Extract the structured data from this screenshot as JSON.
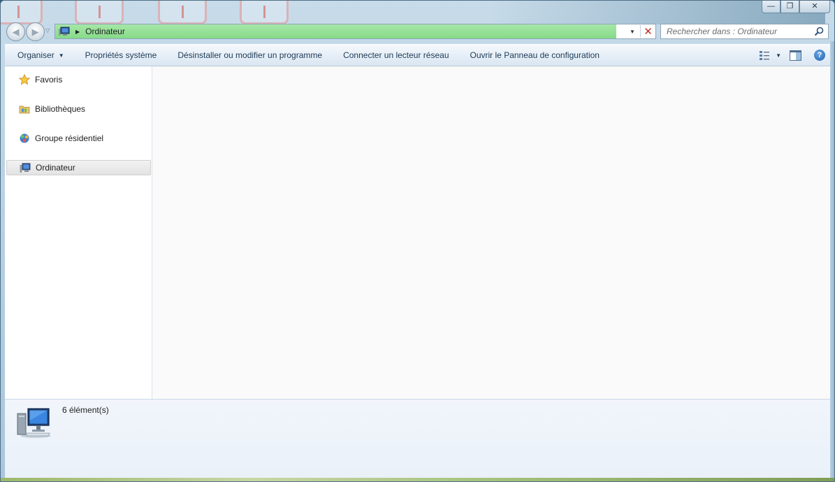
{
  "window": {
    "caption": {
      "minimize": "—",
      "maximize": "❐",
      "close": "✕"
    }
  },
  "navigation": {
    "back_glyph": "◀",
    "forward_glyph": "▶",
    "recent_glyph": "▽"
  },
  "address_bar": {
    "breadcrumb_separator": "▶",
    "location": "Ordinateur",
    "dropdown_glyph": "▼",
    "stop_glyph": "✕",
    "load_progress": 0.935
  },
  "search": {
    "placeholder": "Rechercher dans : Ordinateur"
  },
  "command_bar": {
    "organize": "Organiser",
    "organize_arrow": "▼",
    "items": [
      "Propriétés système",
      "Désinstaller ou modifier un programme",
      "Connecter un lecteur réseau",
      "Ouvrir le Panneau de configuration"
    ],
    "views_arrow": "▼",
    "help": "?"
  },
  "nav_pane": {
    "items": [
      {
        "label": "Favoris",
        "icon": "star-icon"
      },
      {
        "label": "Bibliothèques",
        "icon": "libraries-icon"
      },
      {
        "label": "Groupe résidentiel",
        "icon": "homegroup-icon"
      },
      {
        "label": "Ordinateur",
        "icon": "computer-icon",
        "selected": true
      }
    ]
  },
  "details_pane": {
    "icon": "computer-icon",
    "count": "6 élément(s)"
  },
  "colors": {
    "progress": "#86da88",
    "accent_text": "#1e3a55",
    "stop_red": "#c0312b"
  }
}
